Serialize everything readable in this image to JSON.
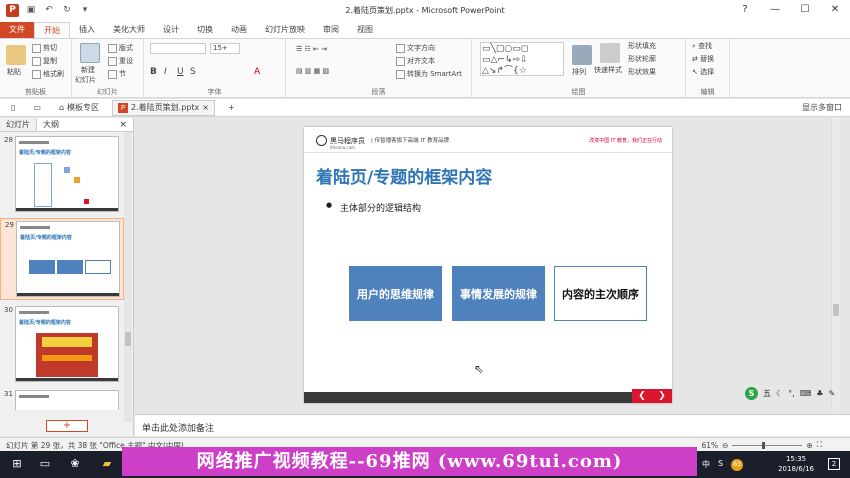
{
  "window": {
    "title": "2.着陆页策划.pptx - Microsoft PowerPoint",
    "help": "?",
    "minimize": "—",
    "restore": "☐",
    "close": "✕"
  },
  "ribbon_tabs": [
    "文件",
    "开始",
    "插入",
    "美化大师",
    "设计",
    "切换",
    "动画",
    "幻灯片放映",
    "审阅",
    "视图"
  ],
  "ribbon": {
    "clipboard": {
      "paste": "粘贴",
      "cut": "剪切",
      "copy": "复制",
      "format_painter": "格式刷",
      "label": "剪贴板"
    },
    "slides": {
      "new_slide": "新建",
      "new_slide2": "幻灯片",
      "layout": "版式",
      "reset": "重设",
      "section": "节",
      "label": "幻灯片"
    },
    "font": {
      "size": "15+",
      "label": "字体"
    },
    "paragraph": {
      "text_direction": "文字方向",
      "align_text": "对齐文本",
      "smartart": "转换为 SmartArt",
      "label": "段落"
    },
    "drawing": {
      "arrange": "排列",
      "quick_styles": "快速样式",
      "shape_fill": "形状填充",
      "shape_outline": "形状轮廓",
      "shape_effects": "形状效果",
      "label": "绘图"
    },
    "editing": {
      "find": "查找",
      "replace": "替换",
      "select": "选择",
      "label": "编辑"
    }
  },
  "doc_tabs": {
    "template": "模板专区",
    "file": "2.着陆页策划.pptx",
    "add": "+",
    "show_multi": "显示多窗口"
  },
  "panel": {
    "tab_slides": "幻灯片",
    "tab_outline": "大纲",
    "close": "×",
    "thumbnails": [
      {
        "num": "28",
        "title": "着陆页/专题的框架内容"
      },
      {
        "num": "29",
        "title": "着陆页/专题的框架内容"
      },
      {
        "num": "30",
        "title": "着陆页/专题的框架内容"
      },
      {
        "num": "31",
        "title": ""
      }
    ],
    "add": "+"
  },
  "slide": {
    "brand": "黑马程序员",
    "brand_sub": "itheima.com",
    "slogan": "| 传智播客旗下高端 IT 教育品牌",
    "header_right": "改变中国 IT 教育，我们正在行动",
    "title": "着陆页/专题的框架内容",
    "bullet": "主体部分的逻辑结构",
    "boxes": [
      "用户的思维规律",
      "事情发展的规律",
      "内容的主次顺序"
    ],
    "prev": "❮",
    "next": "❯"
  },
  "notes": {
    "placeholder": "单击此处添加备注"
  },
  "ime": {
    "logo": "S",
    "mode": "五"
  },
  "status": {
    "slide_info": "幻灯片 第 29 张，共 38 张",
    "theme": "\"Office 主题\"",
    "language": "中文(中国)",
    "zoom": "61%"
  },
  "banner": "网络推广视频教程--69推网 (www.69tui.com)",
  "taskbar": {
    "time": "15:35",
    "date": "2018/6/16",
    "start": "⊞",
    "ime_tray": "中",
    "badge": "83"
  },
  "colors": {
    "accent": "#d24726",
    "slide_blue": "#4f81bd",
    "title_blue": "#2e75b6",
    "banner": "#ce3fc8"
  }
}
